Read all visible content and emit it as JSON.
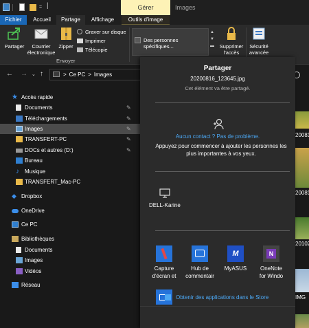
{
  "window": {
    "manage_tab": "Gérer",
    "title": "Images"
  },
  "ribbon_tabs": {
    "file": "Fichier",
    "home": "Accueil",
    "share": "Partage",
    "view": "Affichage",
    "picture_tools": "Outils d'image"
  },
  "ribbon": {
    "share": "Partager",
    "email_line1": "Courrier",
    "email_line2": "électronique",
    "zip": "Zipper",
    "burn": "Graver sur disque",
    "print": "Imprimer",
    "fax": "Télécopie",
    "send_group": "Envoyer",
    "people_item": "Des personnes spécifiques...",
    "remove_line1": "Supprimer",
    "remove_line2": "l'accès",
    "security_line1": "Sécurité",
    "security_line2": "avancée"
  },
  "address": {
    "pc": "Ce PC",
    "sep": ">",
    "folder": "Images"
  },
  "sidebar": {
    "items": [
      {
        "label": "Accès rapide",
        "icon": "star-icon"
      },
      {
        "label": "Documents",
        "icon": "documents-icon"
      },
      {
        "label": "Téléchargements",
        "icon": "download-icon"
      },
      {
        "label": "Images",
        "icon": "images-icon"
      },
      {
        "label": "TRANSFERT-PC",
        "icon": "folder-icon"
      },
      {
        "label": "DOCs et autres (D:)",
        "icon": "drive-icon"
      },
      {
        "label": "Bureau",
        "icon": "desktop-icon"
      },
      {
        "label": "Musique",
        "icon": "music-icon"
      },
      {
        "label": "TRANSFERT_Mac-PC",
        "icon": "folder-icon"
      },
      {
        "label": "Dropbox",
        "icon": "dropbox-icon"
      },
      {
        "label": "OneDrive",
        "icon": "cloud-icon"
      },
      {
        "label": "Ce PC",
        "icon": "computer-icon"
      },
      {
        "label": "Bibliothèques",
        "icon": "library-icon"
      },
      {
        "label": "Documents",
        "icon": "documents-icon"
      },
      {
        "label": "Images",
        "icon": "images-icon"
      },
      {
        "label": "Vidéos",
        "icon": "video-icon"
      },
      {
        "label": "Réseau",
        "icon": "network-icon"
      }
    ]
  },
  "thumbnails": {
    "labels": [
      "20081",
      "20081",
      "20102",
      "IMG"
    ]
  },
  "share_panel": {
    "title": "Partager",
    "filename": "20200816_123645.jpg",
    "subtitle": "Cet élément va être partagé.",
    "no_contact": "Aucun contact ? Pas de problème.",
    "no_contact_desc": "Appuyez pour commencer à ajouter les personnes les plus importantes à vos yeux.",
    "device": "DELL-Karine",
    "apps": [
      {
        "line1": "Capture",
        "line2": "d'écran et"
      },
      {
        "line1": "Hub de",
        "line2": "commentair"
      },
      {
        "line1": "MyASUS",
        "line2": ""
      },
      {
        "line1": "OneNote",
        "line2": "for Windo"
      }
    ],
    "store": "Obtenir des applications dans le Store"
  }
}
